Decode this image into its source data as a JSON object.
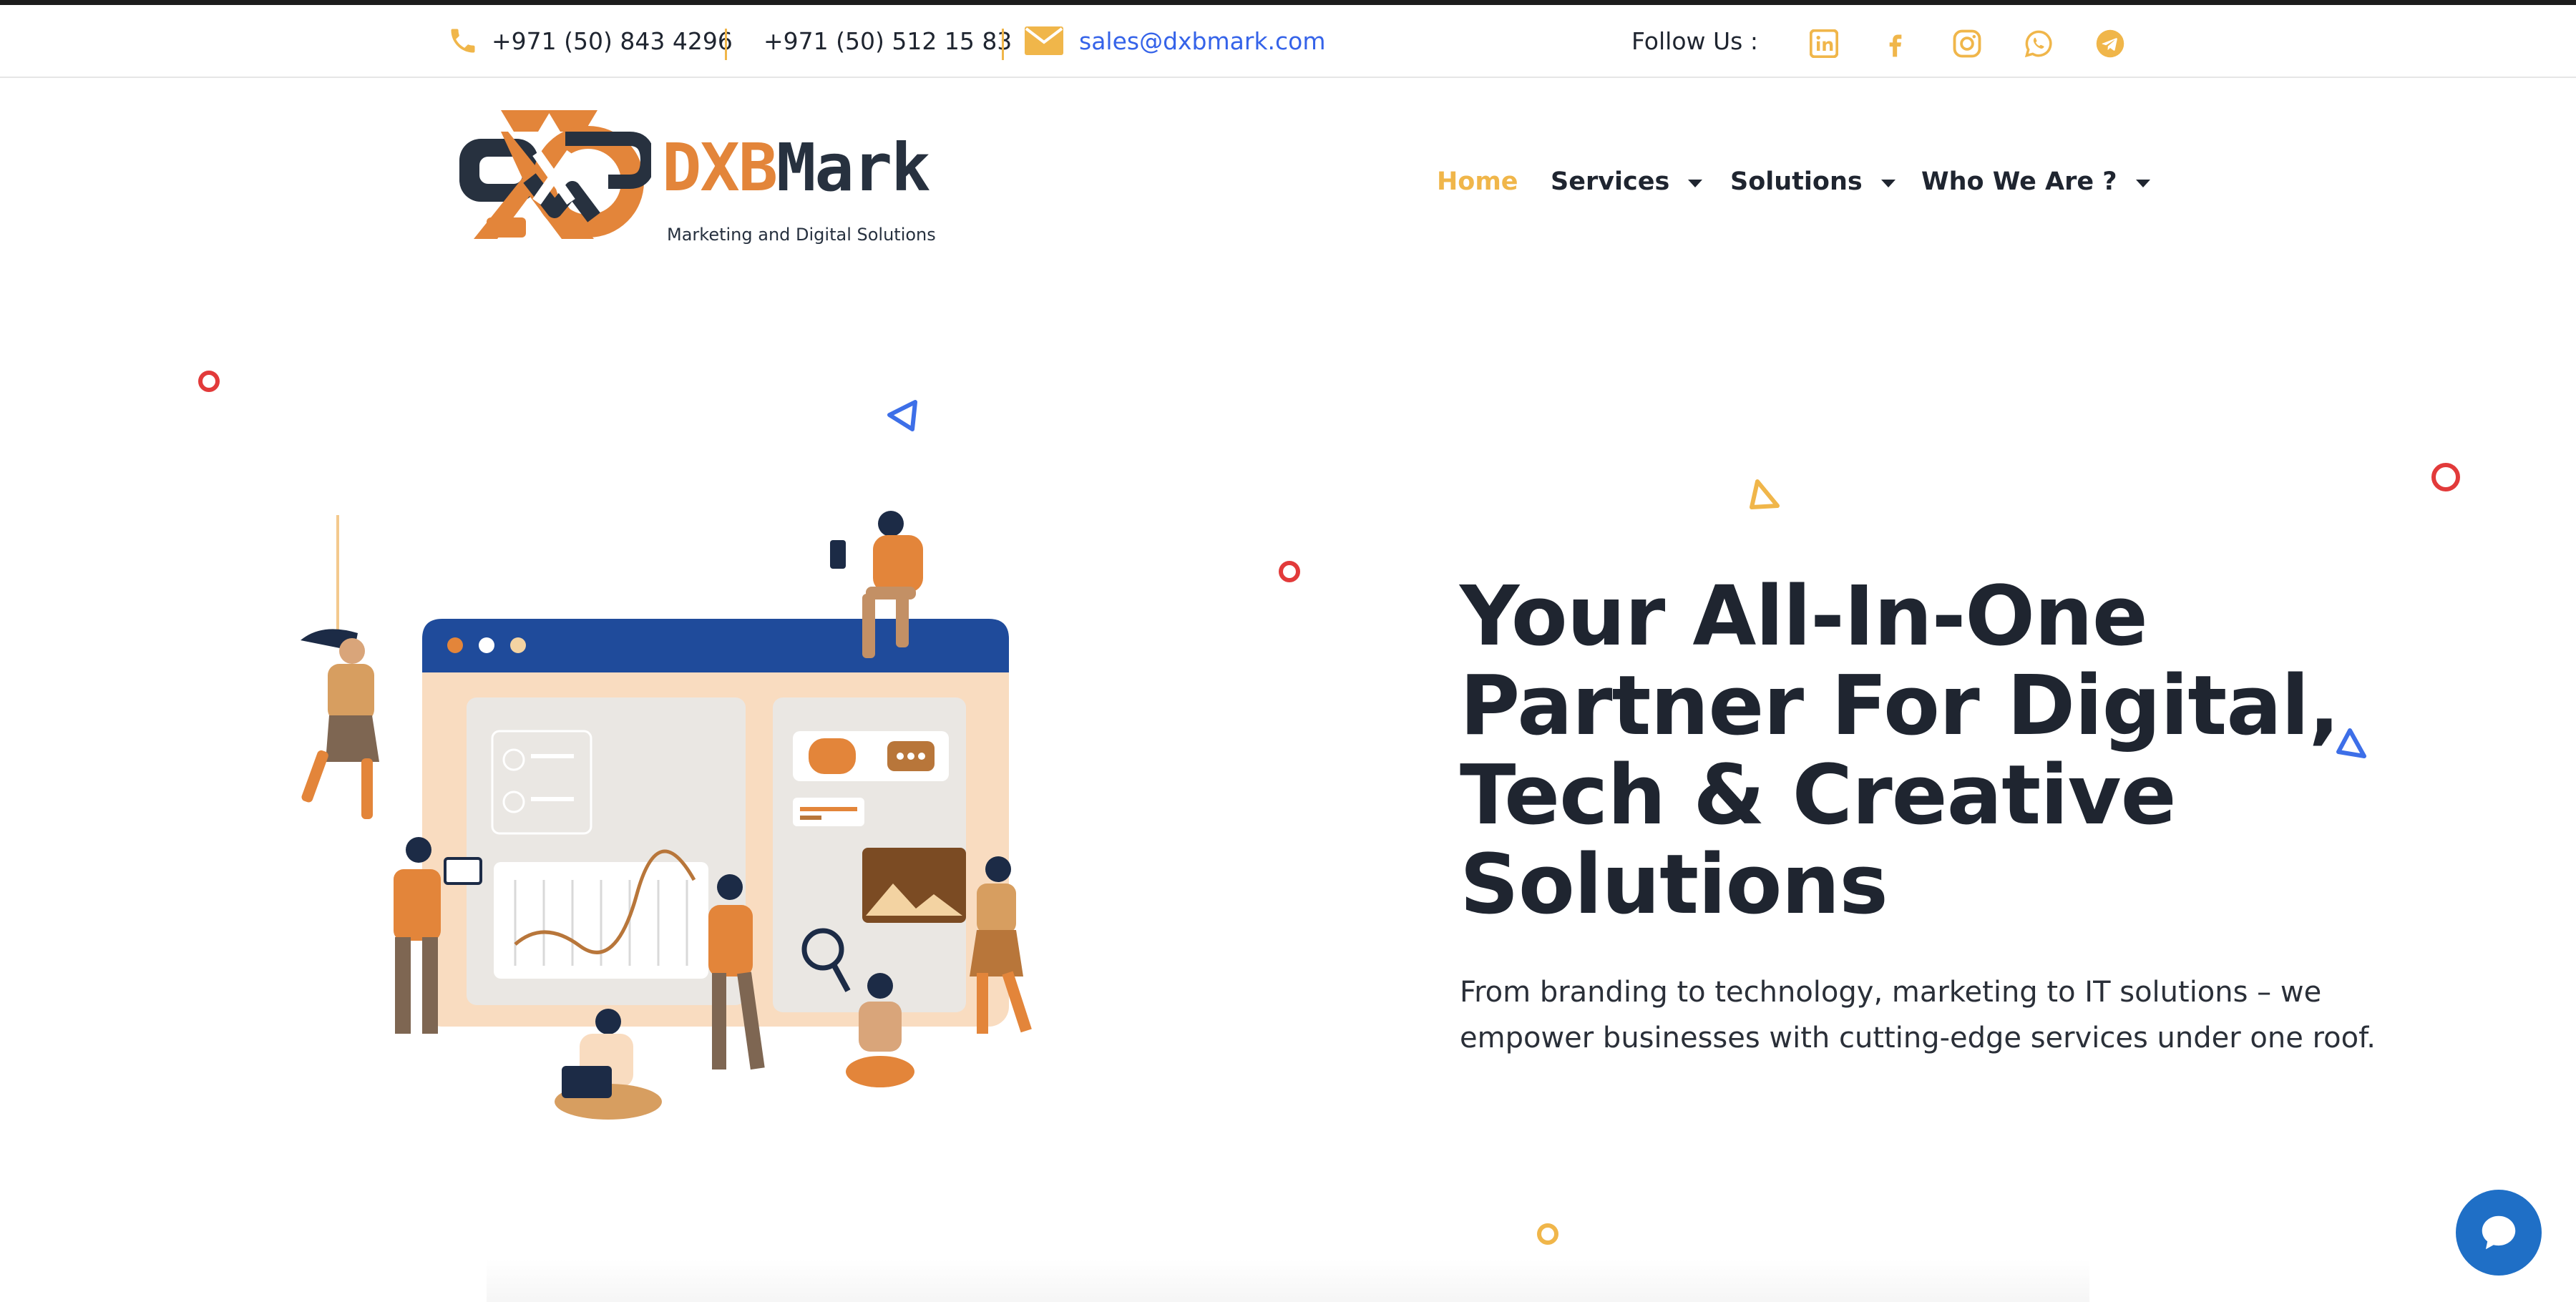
{
  "topbar": {
    "phone_1": "+971 (50) 843 4296",
    "phone_2": "+971 (50) 512 15 83",
    "email": "sales@dxbmark.com",
    "follow_label": "Follow Us :",
    "socials": [
      "linkedin-icon",
      "facebook-icon",
      "instagram-icon",
      "whatsapp-icon",
      "telegram-icon"
    ],
    "icon_color": "#f0b64a"
  },
  "brand": {
    "name_part1": "DXB",
    "name_part2": "Mark",
    "tagline": "Marketing and Digital Solutions",
    "orange": "#e3853a",
    "dark": "#27313f"
  },
  "nav": {
    "items": [
      {
        "label": "Home",
        "active": true
      },
      {
        "label": "Services",
        "dropdown": true
      },
      {
        "label": "Solutions",
        "dropdown": true
      },
      {
        "label": "Who We Are ?",
        "dropdown": true
      }
    ],
    "active_color": "#f0b64a"
  },
  "hero": {
    "title_lines": [
      "Your All-In-One",
      "Partner For Digital,",
      "Tech & Creative",
      "Solutions"
    ],
    "subtitle_lines": [
      "From branding to technology, marketing to IT solutions – we",
      "empower businesses with cutting-edge services under one roof."
    ]
  },
  "chat": {
    "icon": "chat-bubble-icon",
    "color": "#1f6fc6"
  }
}
